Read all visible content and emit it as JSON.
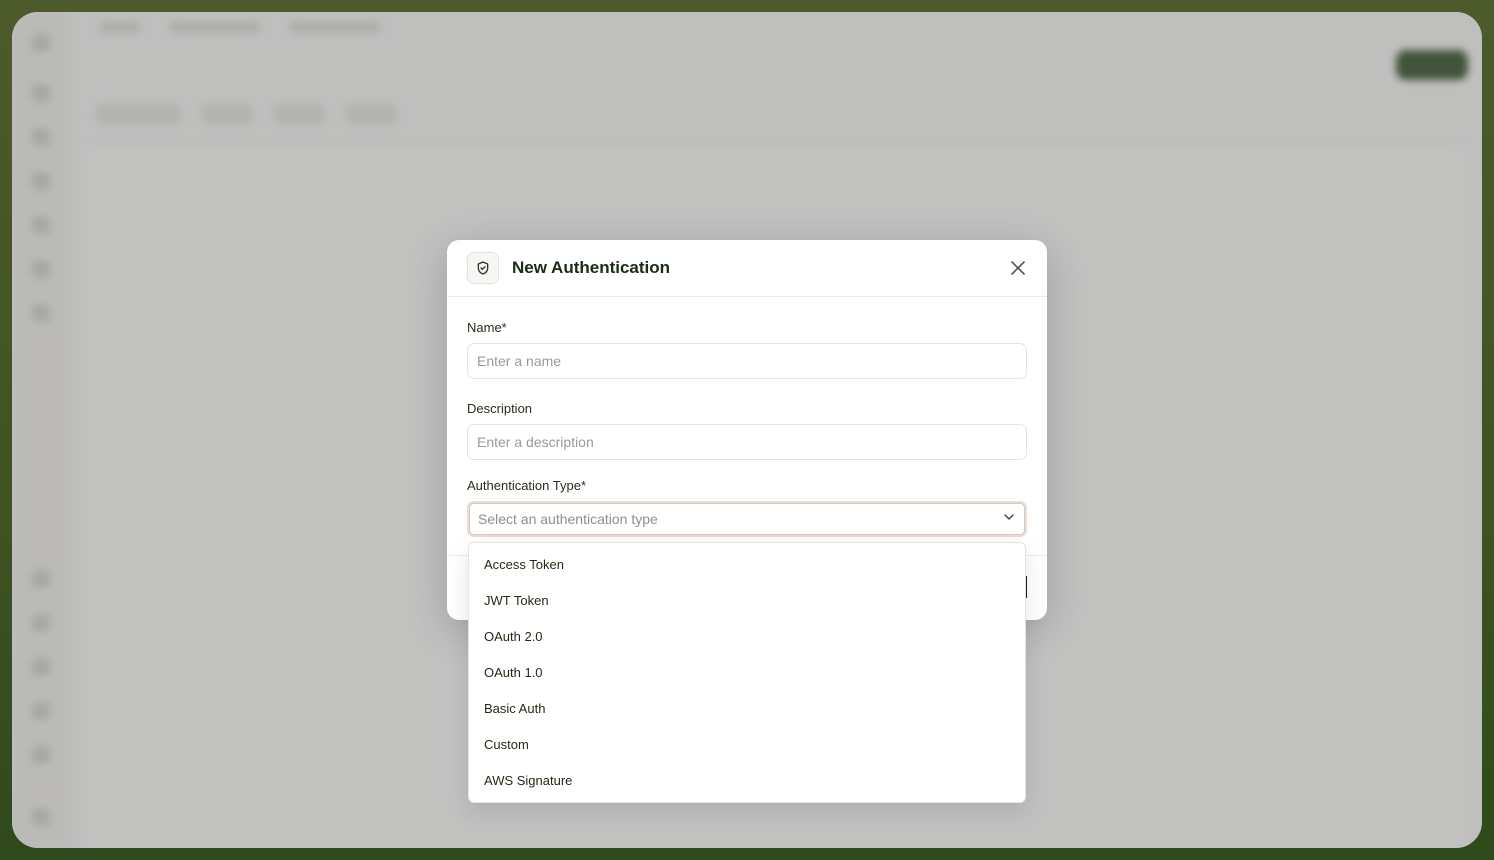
{
  "modal": {
    "title": "New Authentication",
    "name_label": "Name*",
    "name_placeholder": "Enter a name",
    "description_label": "Description",
    "description_placeholder": "Enter a description",
    "auth_type_label": "Authentication Type*",
    "auth_type_placeholder": "Select an authentication type"
  },
  "dropdown": {
    "options": [
      "Access Token",
      "JWT Token",
      "OAuth 2.0",
      "OAuth 1.0",
      "Basic Auth",
      "Custom",
      "AWS Signature"
    ]
  },
  "colors": {
    "accent": "#1d2a14",
    "frame_bg": "#3f5224"
  }
}
